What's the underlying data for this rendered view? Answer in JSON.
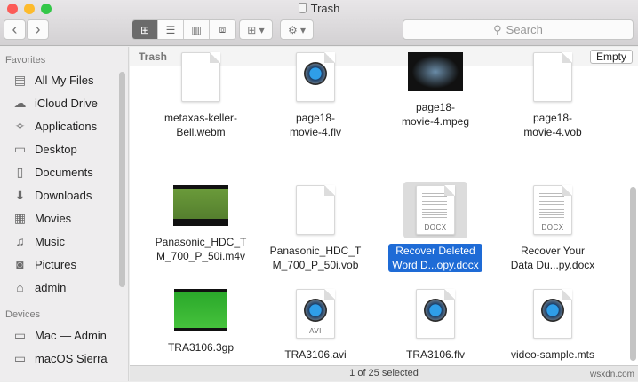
{
  "window": {
    "title": "Trash"
  },
  "toolbar": {
    "back": "‹",
    "forward": "›",
    "search_placeholder": "Search"
  },
  "sidebar": {
    "favorites_header": "Favorites",
    "favorites": [
      {
        "label": "All My Files",
        "icon": "▤"
      },
      {
        "label": "iCloud Drive",
        "icon": "☁"
      },
      {
        "label": "Applications",
        "icon": "✧"
      },
      {
        "label": "Desktop",
        "icon": "▭"
      },
      {
        "label": "Documents",
        "icon": "▯"
      },
      {
        "label": "Downloads",
        "icon": "⬇"
      },
      {
        "label": "Movies",
        "icon": "▦"
      },
      {
        "label": "Music",
        "icon": "♫"
      },
      {
        "label": "Pictures",
        "icon": "◙"
      },
      {
        "label": "admin",
        "icon": "⌂"
      }
    ],
    "devices_header": "Devices",
    "devices": [
      {
        "label": "Mac — Admin",
        "icon": "▭"
      },
      {
        "label": "macOS Sierra",
        "icon": "▭"
      }
    ]
  },
  "main": {
    "header": "Trash",
    "empty_button": "Empty",
    "files": [
      {
        "name1": "metaxas-keller-",
        "name2": "Bell.webm",
        "kind": "blank"
      },
      {
        "name1": "page18-",
        "name2": "movie-4.flv",
        "kind": "qt"
      },
      {
        "name1": "page18-",
        "name2": "movie-4.mpeg",
        "kind": "dark"
      },
      {
        "name1": "page18-",
        "name2": "movie-4.vob",
        "kind": "blank"
      },
      {
        "name1": "Panasonic_HDC_T",
        "name2": "M_700_P_50i.m4v",
        "kind": "green"
      },
      {
        "name1": "Panasonic_HDC_T",
        "name2": "M_700_P_50i.vob",
        "kind": "blank"
      },
      {
        "name1": "Recover Deleted",
        "name2": "Word D...opy.docx",
        "kind": "docx",
        "tag": "DOCX",
        "selected": true
      },
      {
        "name1": "Recover Your",
        "name2": "Data Du...py.docx",
        "kind": "docx",
        "tag": "DOCX"
      },
      {
        "name1": "TRA3106.3gp",
        "name2": "",
        "kind": "solidgreen"
      },
      {
        "name1": "TRA3106.avi",
        "name2": "",
        "kind": "qt",
        "tag": "AVI"
      },
      {
        "name1": "TRA3106.flv",
        "name2": "",
        "kind": "qt"
      },
      {
        "name1": "video-sample.mts",
        "name2": "",
        "kind": "qt"
      }
    ]
  },
  "status": {
    "text": "1 of 25 selected",
    "watermark": "wsxdn.com"
  }
}
